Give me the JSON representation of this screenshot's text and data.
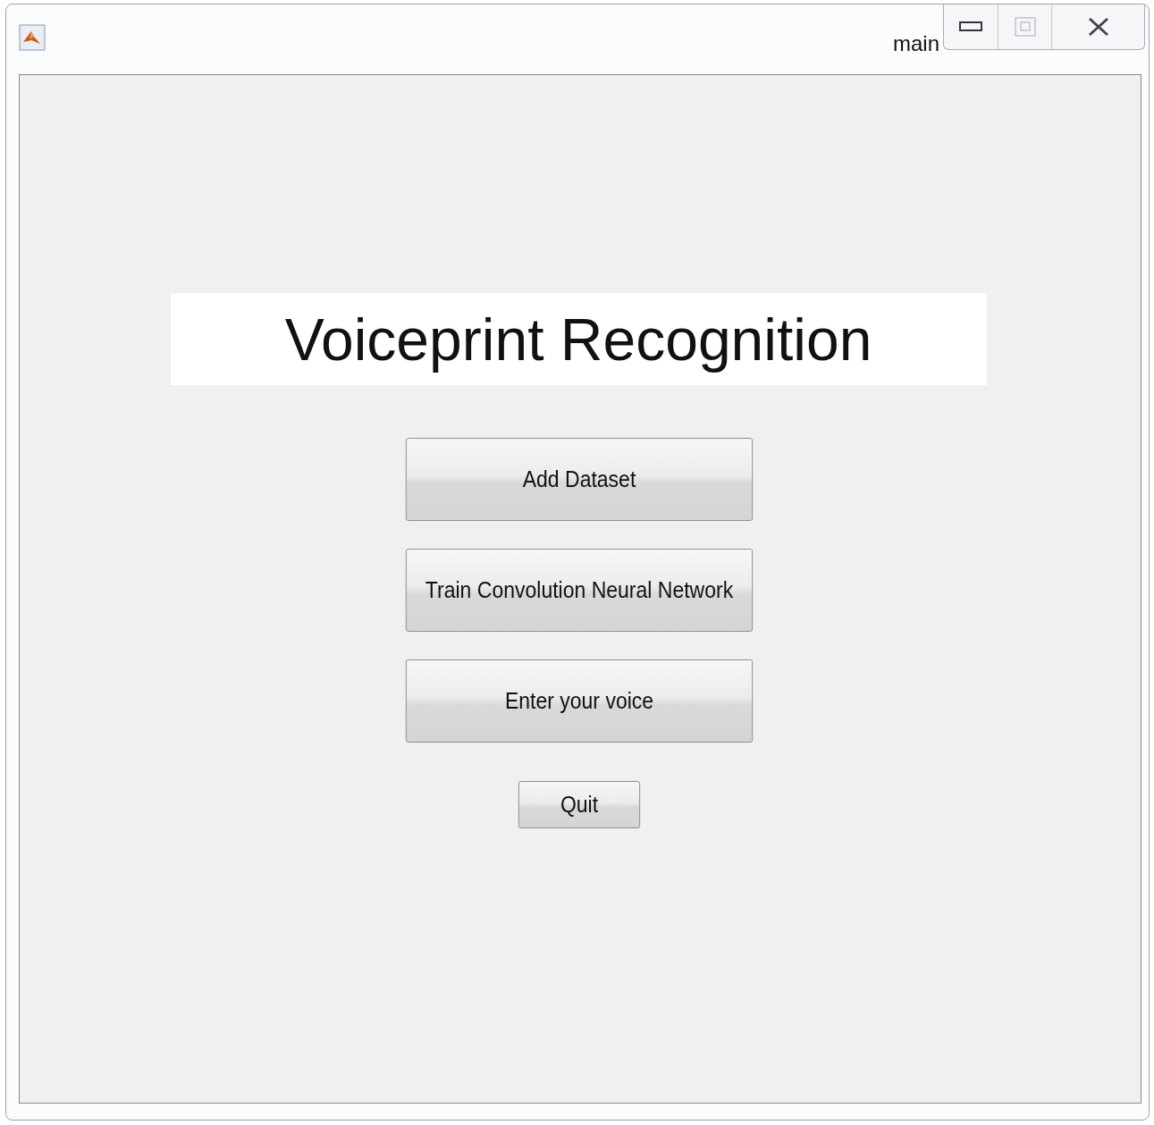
{
  "window": {
    "title": "main"
  },
  "heading": "Voiceprint Recognition",
  "buttons": [
    {
      "label": "Add Dataset",
      "kind": "large"
    },
    {
      "label": "Train Convolution Neural Network",
      "kind": "large"
    },
    {
      "label": "Enter your voice",
      "kind": "large"
    },
    {
      "label": "Quit",
      "kind": "small"
    }
  ]
}
